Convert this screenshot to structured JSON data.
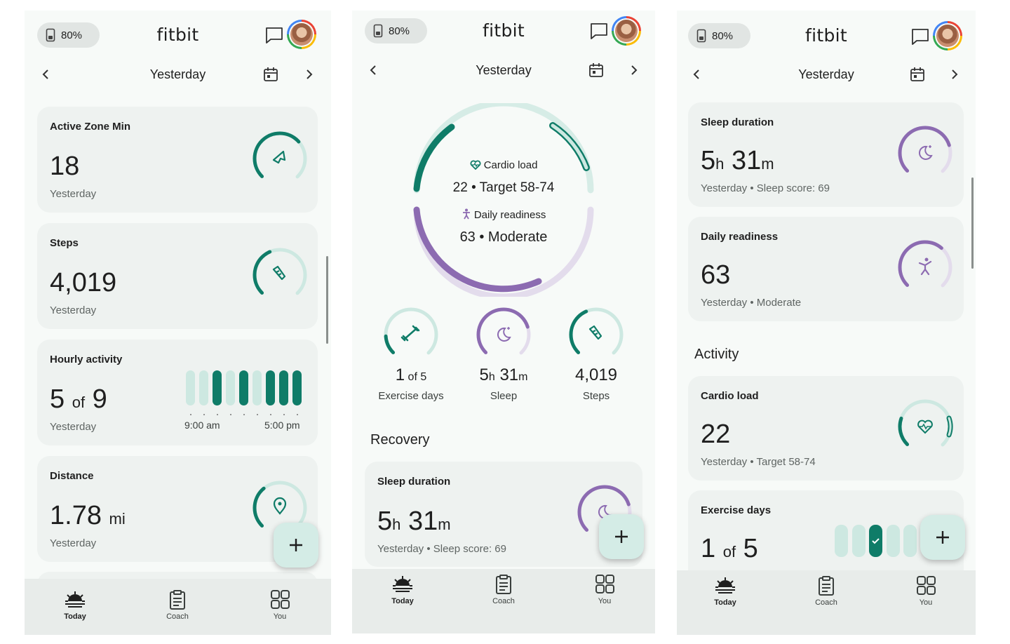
{
  "battery": "80%",
  "app_name": "fitbit",
  "date_label": "Yesterday",
  "colors": {
    "accent": "#0f7c68",
    "accent_light": "#cde8e1",
    "sleep": "#8c6bb1",
    "sleep_light": "#e3dcec",
    "card": "#eef2f0",
    "bg": "#f7faf8"
  },
  "nav": {
    "today": "Today",
    "coach": "Coach",
    "you": "You"
  },
  "screen1": {
    "active_zone": {
      "title": "Active Zone Min",
      "value": "18",
      "sub": "Yesterday",
      "progress": 0.6
    },
    "steps": {
      "title": "Steps",
      "value": "4,019",
      "sub": "Yesterday",
      "progress": 0.4
    },
    "hourly": {
      "title": "Hourly activity",
      "value_num": "5",
      "value_of": "of",
      "value_total": "9",
      "sub": "Yesterday",
      "bars": [
        0,
        0,
        1,
        0,
        1,
        0,
        1,
        1,
        1
      ],
      "start_label": "9:00 am",
      "end_label": "5:00 pm"
    },
    "distance": {
      "title": "Distance",
      "value": "1.78",
      "unit": "mi",
      "sub": "Yesterday",
      "progress": 0.35
    }
  },
  "screen2": {
    "cardio_label": "Cardio load",
    "cardio_value": "22 • Target 58-74",
    "readiness_label": "Daily readiness",
    "readiness_value": "63 • Moderate",
    "minis": [
      {
        "value_num": "1",
        "value_of": "of",
        "value_total": "5",
        "label": "Exercise days"
      },
      {
        "value_h": "5",
        "value_m": "31",
        "label": "Sleep"
      },
      {
        "value": "4,019",
        "label": "Steps"
      }
    ],
    "section_recovery": "Recovery",
    "sleep_card": {
      "title": "Sleep duration",
      "h": "5",
      "m": "31",
      "sub": "Yesterday • Sleep score: 69"
    }
  },
  "screen3": {
    "sleep": {
      "title": "Sleep duration",
      "h": "5",
      "m": "31",
      "sub": "Yesterday • Sleep score: 69"
    },
    "readiness": {
      "title": "Daily readiness",
      "value": "63",
      "sub": "Yesterday • Moderate"
    },
    "section_activity": "Activity",
    "cardio": {
      "title": "Cardio load",
      "value": "22",
      "sub": "Yesterday • Target 58-74"
    },
    "exercise": {
      "title": "Exercise days",
      "value_num": "1",
      "value_of": "of",
      "value_total": "5",
      "bars": [
        0,
        0,
        1,
        0,
        0
      ]
    }
  }
}
